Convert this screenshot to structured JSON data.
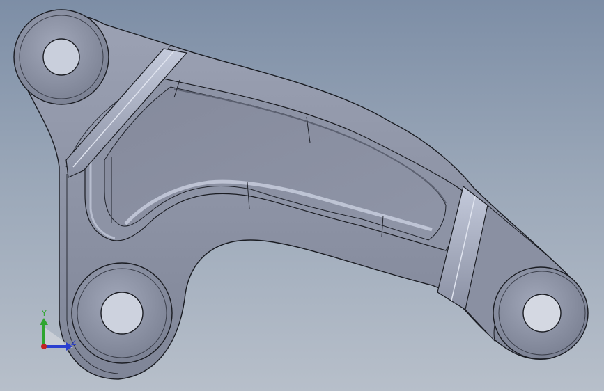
{
  "viewport": {
    "background_top": "#7d8ea6",
    "background_bottom": "#b7bfca"
  },
  "part": {
    "body_color": "#8e94a6",
    "edge_color": "#1a1c22",
    "highlight_color": "#c3c9d9",
    "shadow_color": "#5f6475"
  },
  "triad": {
    "y_label": "Y",
    "z_label": "Z",
    "y_color": "#2fa52f",
    "z_color": "#2b3fd0",
    "origin_color": "#c22222"
  }
}
